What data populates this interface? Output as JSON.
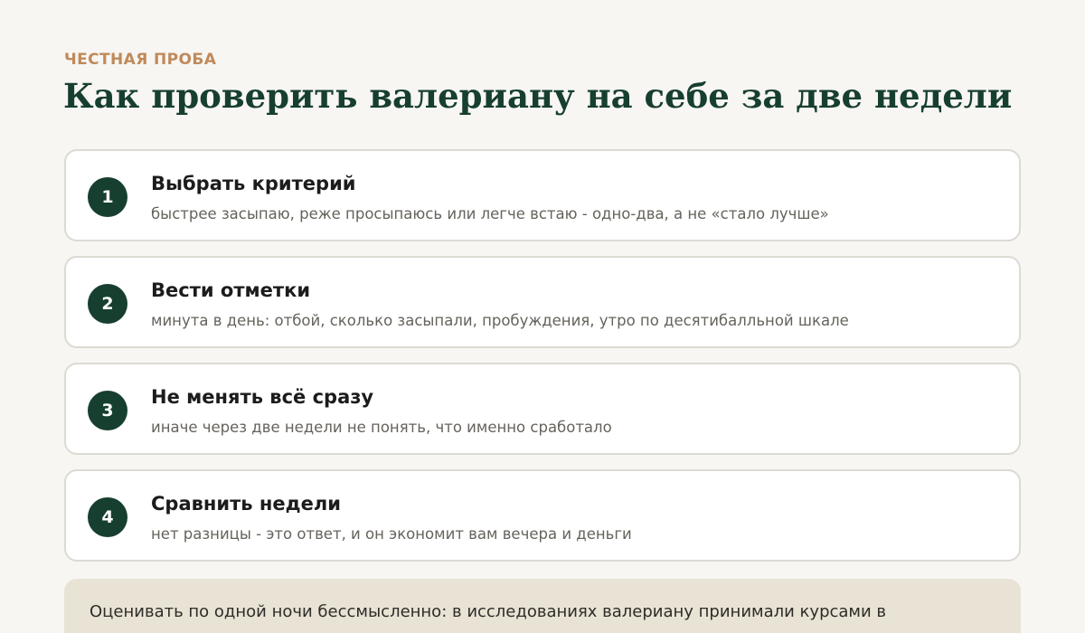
{
  "header": {
    "eyebrow": "ЧЕСТНАЯ ПРОБА",
    "title": "Как проверить валериану на себе за две недели"
  },
  "steps": [
    {
      "number": "1",
      "title": "Выбрать критерий",
      "description": "быстрее засыпаю, реже просыпаюсь или легче встаю - одно-два, а не «стало лучше»"
    },
    {
      "number": "2",
      "title": "Вести отметки",
      "description": "минута в день: отбой, сколько засыпали, пробуждения, утро по десятибалльной шкале"
    },
    {
      "number": "3",
      "title": "Не менять всё сразу",
      "description": "иначе через две недели не понять, что именно сработало"
    },
    {
      "number": "4",
      "title": "Сравнить недели",
      "description": "нет разницы - это ответ, и он экономит вам вечера и деньги"
    }
  ],
  "note": {
    "text": "Оценивать по одной ночи бессмысленно: в исследованиях валериану принимали курсами в"
  },
  "colors": {
    "accent": "#c08a5a",
    "primary": "#173f30",
    "background": "#f7f6f3",
    "card_border": "#dcdad3",
    "note_background": "#e9e3d6"
  }
}
